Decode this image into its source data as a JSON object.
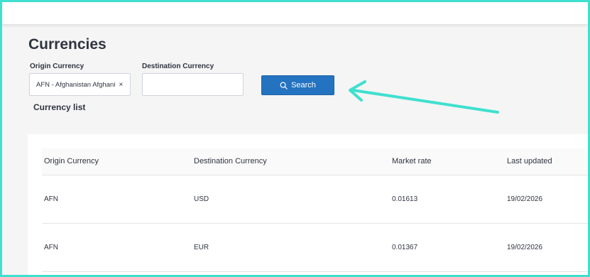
{
  "page": {
    "title": "Currencies"
  },
  "filters": {
    "origin_label": "Origin Currency",
    "origin_value": "AFN - Afghanistan Afghani",
    "clear_glyph": "×",
    "destination_label": "Destination Currency",
    "destination_value": "",
    "search_label": "Search",
    "search_icon": "search-icon"
  },
  "list": {
    "title": "Currency list",
    "columns": [
      "Origin Currency",
      "Destination Currency",
      "Market rate",
      "Last updated"
    ],
    "rows": [
      {
        "origin": "AFN",
        "destination": "USD",
        "rate": "0.01613",
        "updated": "19/02/2026"
      },
      {
        "origin": "AFN",
        "destination": "EUR",
        "rate": "0.01367",
        "updated": "19/02/2026"
      }
    ]
  },
  "colors": {
    "accent": "#2473c0",
    "annotation_arrow": "#3fe0cf",
    "text": "#2f3440"
  }
}
